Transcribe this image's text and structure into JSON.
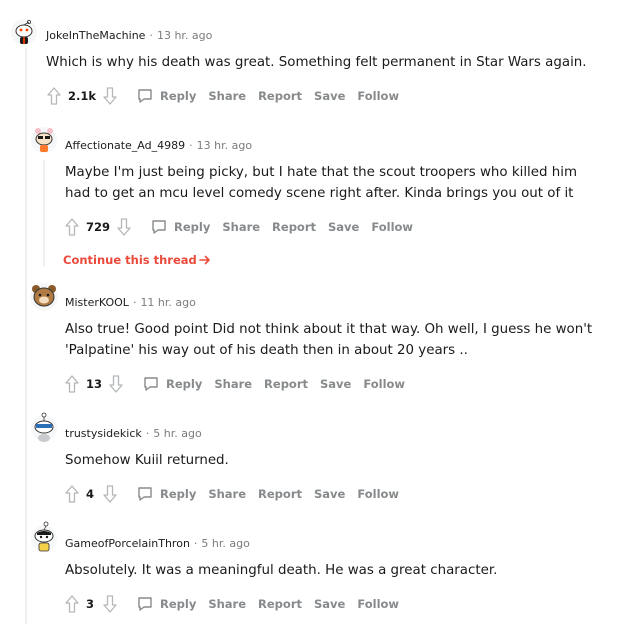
{
  "comments": [
    {
      "author": "JokeInTheMachine",
      "time": "13 hr. ago",
      "text": "Which is why his death was great. Something felt permanent in Star Wars again.",
      "score": "2.1k"
    },
    {
      "author": "Affectionate_Ad_4989",
      "time": "13 hr. ago",
      "text": "Maybe I'm just being picky, but I hate that the scout troopers who killed him had to get an mcu level comedy scene right after. Kinda brings you out of it",
      "score": "729"
    },
    {
      "author": "MisterKOOL",
      "time": "11 hr. ago",
      "text": "Also true! Good point Did not think about it that way. Oh well, I guess he won't 'Palpatine' his way out of his death then in about 20 years ..",
      "score": "13"
    },
    {
      "author": "trustysidekick",
      "time": "5 hr. ago",
      "text": "Somehow Kuiil returned.",
      "score": "4"
    },
    {
      "author": "GameofPorcelainThron",
      "time": "5 hr. ago",
      "text": "Absolutely. It was a meaningful death. He was a great character.",
      "score": "3"
    }
  ],
  "actions": {
    "reply": "Reply",
    "share": "Share",
    "report": "Report",
    "save": "Save",
    "follow": "Follow"
  },
  "continue_thread": "Continue this thread",
  "icons": {
    "upvote": "upvote-icon",
    "downvote": "downvote-icon",
    "reply": "comment-bubble-icon",
    "avatar": "snoo-avatar-icon",
    "continue": "arrow-right-icon"
  },
  "colors": {
    "accent": "#ea4a3b",
    "muted": "#878a8c",
    "line": "#edeff1"
  }
}
